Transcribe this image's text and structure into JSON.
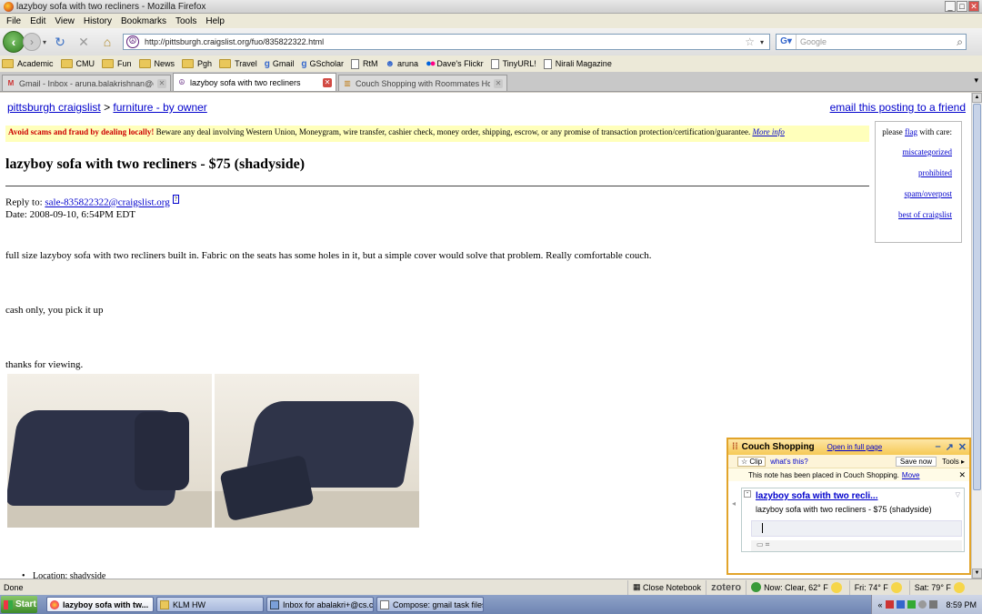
{
  "window": {
    "title": "lazyboy sofa with two recliners - Mozilla Firefox"
  },
  "menu": [
    "File",
    "Edit",
    "View",
    "History",
    "Bookmarks",
    "Tools",
    "Help"
  ],
  "nav": {
    "url": "http://pittsburgh.craigslist.org/fuo/835822322.html",
    "search_placeholder": "Google"
  },
  "bookmarks": [
    {
      "label": "Academic",
      "icon": "folder"
    },
    {
      "label": "CMU",
      "icon": "folder"
    },
    {
      "label": "Fun",
      "icon": "folder"
    },
    {
      "label": "News",
      "icon": "folder"
    },
    {
      "label": "Pgh",
      "icon": "folder"
    },
    {
      "label": "Travel",
      "icon": "folder"
    },
    {
      "label": "Gmail",
      "icon": "google"
    },
    {
      "label": "GScholar",
      "icon": "google"
    },
    {
      "label": "RtM",
      "icon": "rtm"
    },
    {
      "label": "aruna",
      "icon": "aruna"
    },
    {
      "label": "Dave's Flickr",
      "icon": "flickr"
    },
    {
      "label": "TinyURL!",
      "icon": "page"
    },
    {
      "label": "Nirali Magazine",
      "icon": "page"
    }
  ],
  "tabs": [
    {
      "label": "Gmail - Inbox - aruna.balakrishnan@gma...",
      "active": false
    },
    {
      "label": "lazyboy sofa with two recliners",
      "active": true
    },
    {
      "label": "Couch Shopping with Roommates Home...",
      "active": false
    }
  ],
  "page": {
    "city": "pittsburgh craigslist",
    "sep": ">",
    "category": "furniture - by owner",
    "email_posting": "email this posting to a friend",
    "warning_bold": "Avoid scams and fraud by dealing locally!",
    "warning_text": "Beware any deal involving Western Union, Moneygram, wire transfer, cashier check, money order, shipping, escrow, or any promise of transaction protection/certification/guarantee.",
    "more_info": "More info",
    "flag": {
      "pre": "please",
      "link": "flag",
      "post": "with care:",
      "links": [
        "miscategorized",
        "prohibited",
        "spam/overpost",
        "best of craigslist"
      ]
    },
    "title": "lazyboy sofa with two recliners - $75 (shadyside)",
    "reply_label": "Reply to:",
    "reply_email": "sale-835822322@craigslist.org",
    "date": "Date: 2008-09-10, 6:54PM EDT",
    "body1": "full size lazyboy sofa with two recliners built in. Fabric on the seats has some holes in it, but a simple cover would solve that problem. Really comfortable couch.",
    "body2": "cash only, you pick it up",
    "body3": "thanks for viewing.",
    "location": "Location: shadyside"
  },
  "note": {
    "title": "Couch Shopping",
    "open_full": "Open in full page",
    "clip": "Clip",
    "whats_this": "what's this?",
    "save_now": "Save now",
    "tools": "Tools",
    "msg": "This note has been placed in Couch Shopping.",
    "move": "Move",
    "card_title": "lazyboy sofa with two recli...",
    "card_body": "lazyboy sofa with two recliners - $75 (shadyside)"
  },
  "status": {
    "done": "Done",
    "close_notebook": "Close Notebook",
    "zotero": "zotero",
    "weather_now": "Now: Clear, 62° F",
    "weather_fri": "Fri: 74° F",
    "weather_sat": "Sat: 79° F"
  },
  "taskbar": {
    "start": "Start",
    "tasks": [
      "lazyboy sofa with tw...",
      "KLM HW",
      "Inbox for abalakri+@cs.c...",
      "Compose: gmail task files"
    ],
    "time": "8:59 PM"
  }
}
